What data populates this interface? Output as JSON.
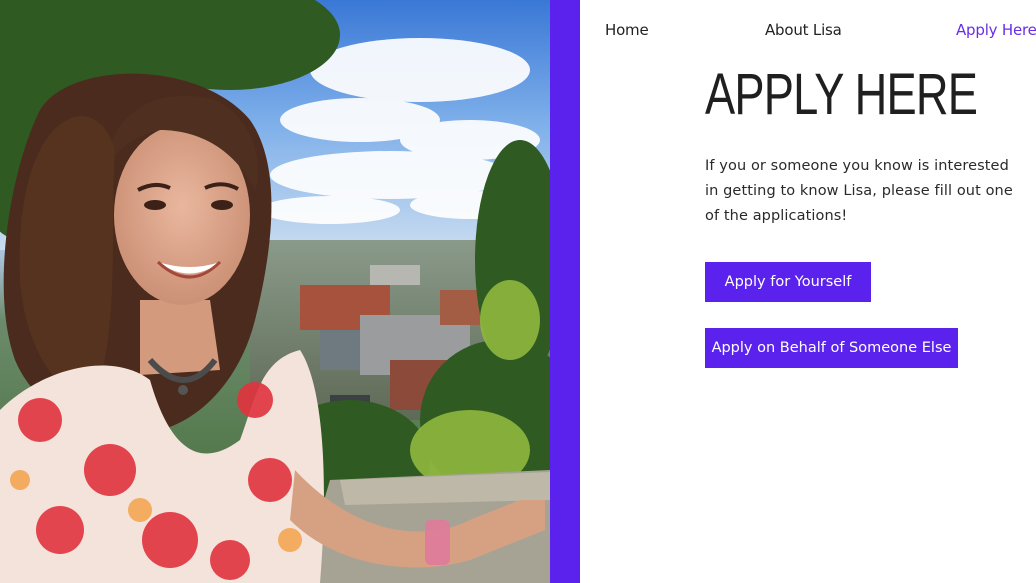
{
  "nav": {
    "items": [
      {
        "label": "Home"
      },
      {
        "label": "About Lisa"
      },
      {
        "label": "Apply Here",
        "active": true
      }
    ]
  },
  "main": {
    "heading": "APPLY HERE",
    "intro": "If you or someone you know is interested in getting to know Lisa, please fill out one of the applications!",
    "buttons": {
      "apply_self": "Apply for Yourself",
      "apply_other": "Apply on Behalf of Someone Else"
    }
  },
  "colors": {
    "accent": "#5a22ec",
    "active_nav": "#6a2de6",
    "text": "#222222"
  },
  "photo": {
    "subject": "photo"
  }
}
